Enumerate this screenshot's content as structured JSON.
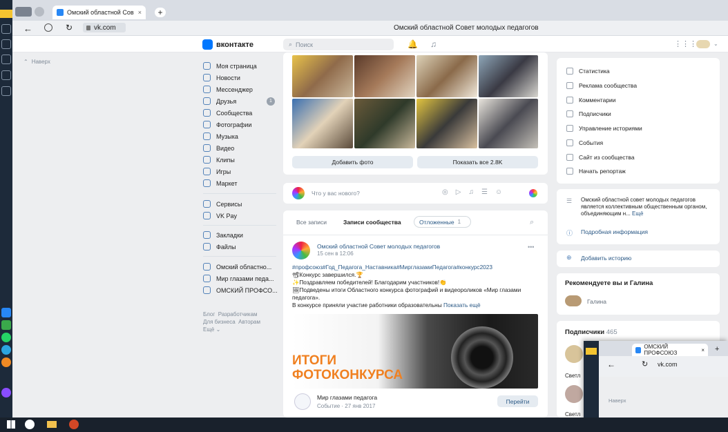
{
  "browser": {
    "tab1_title": "Омский областной Сов",
    "tab2_title": "ОМСКИЙ ПРОФСОЮЗ",
    "url": "vk.com",
    "page_title": "Омский областной Совет молодых педагогов",
    "back_label": "Наверх"
  },
  "vk": {
    "logo": "вконтакте",
    "search_placeholder": "Поиск"
  },
  "nav": {
    "items": [
      {
        "label": "Моя страница"
      },
      {
        "label": "Новости"
      },
      {
        "label": "Мессенджер"
      },
      {
        "label": "Друзья",
        "badge": "1"
      },
      {
        "label": "Сообщества"
      },
      {
        "label": "Фотографии"
      },
      {
        "label": "Музыка"
      },
      {
        "label": "Видео"
      },
      {
        "label": "Клипы"
      },
      {
        "label": "Игры"
      },
      {
        "label": "Маркет"
      },
      {
        "label": "Сервисы"
      },
      {
        "label": "VK Pay"
      },
      {
        "label": "Закладки"
      },
      {
        "label": "Файлы"
      },
      {
        "label": "Омский областно..."
      },
      {
        "label": "Мир глазами педа..."
      },
      {
        "label": "ОМСКИЙ ПРОФСО..."
      }
    ],
    "footer": [
      "Блог",
      "Разработчикам",
      "Для бизнеса",
      "Авторам",
      "Ещё"
    ]
  },
  "photos": {
    "add_label": "Добавить фото",
    "show_all_label": "Показать все 2.8K"
  },
  "composer": {
    "placeholder": "Что у вас нового?"
  },
  "wall": {
    "tabs": [
      "Все записи",
      "Записи сообщества",
      "Отложенные"
    ],
    "deferred_count": "1"
  },
  "post": {
    "author": "Омский областной Совет молодых педагогов",
    "date": "15 сен в 12:06",
    "line1": "#профсоюз#Год_Педагога_Наставника#МирглазамиПедагога#конкурс2023",
    "line2": "Конкурс завершился.",
    "line3": "Поздравляем победителей! Благодарим участников!",
    "line4": "Подведены итоги Областного конкурса фотографий и видеороликов «Мир глазами педагога».",
    "line5": "В конкурсе приняли участие работники образовательны",
    "more": "Показать ещё",
    "image_line1": "ИТОГИ",
    "image_line2": "ФОТОКОНКУРСА"
  },
  "event": {
    "title": "Мир глазами педагога",
    "subtitle": "Событие · 27 янв 2017",
    "button": "Перейти"
  },
  "right": {
    "menu": [
      "Статистика",
      "Реклама сообщества",
      "Комментарии",
      "Подписчики",
      "Управление историями",
      "События",
      "Сайт из сообщества",
      "Начать репортаж"
    ],
    "about": "Омский областной совет молодых педагогов является коллективным общественным органом, объединяющим н...",
    "about_more": "Ещё",
    "details": "Подробная информация",
    "add_story": "Добавить историю",
    "recommend_title": "Рекомендуете вы и Галина",
    "recommend_name": "Галина",
    "subs_title": "Подписчики",
    "subs_count": "465",
    "sub1": "Светл",
    "sub2": "Светл"
  }
}
